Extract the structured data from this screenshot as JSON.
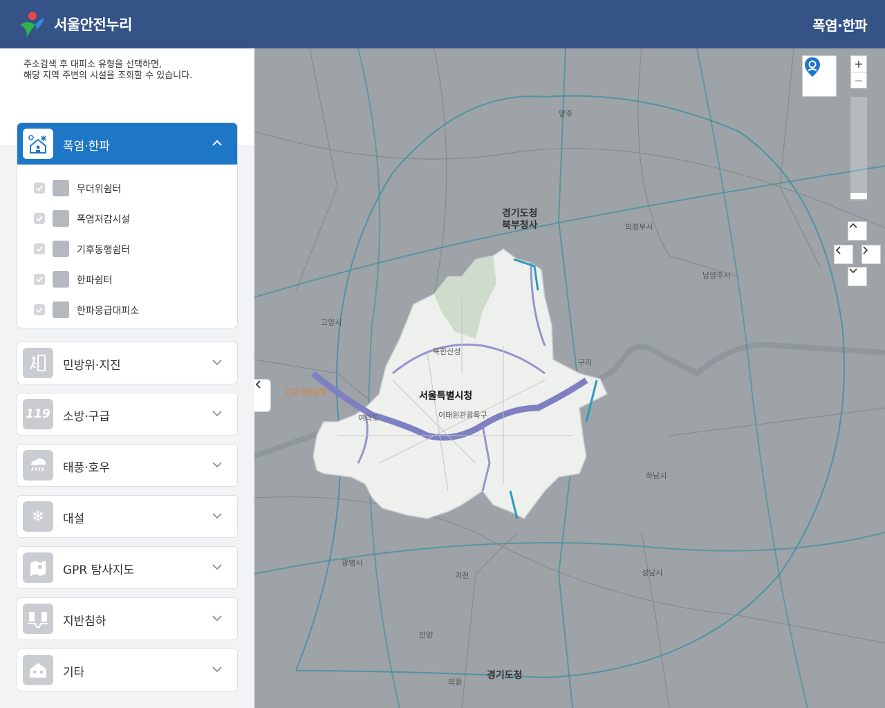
{
  "header": {
    "app_title": "서울안전누리",
    "page_title": "폭염·한파"
  },
  "sidebar": {
    "intro_line1": "주소검색 후 대피소 유형을 선택하면,",
    "intro_line2": "해당 지역 주변의 시설을 조회할 수 있습니다.",
    "open_category": {
      "label": "폭염·한파",
      "icon": "heat-cold-icon",
      "items": [
        {
          "label": "무더위쉼터",
          "icon": "heat-shelter-icon",
          "checked": true
        },
        {
          "label": "폭염저감시설",
          "icon": "heat-reduction-icon",
          "checked": true
        },
        {
          "label": "기후동행쉼터",
          "icon": "climate-shelter-icon",
          "checked": true
        },
        {
          "label": "한파쉼터",
          "icon": "cold-shelter-icon",
          "checked": true
        },
        {
          "label": "한파응급대피소",
          "icon": "cold-emergency-icon",
          "checked": true
        }
      ]
    },
    "categories": [
      {
        "label": "민방위·지진",
        "icon": "evacuation-icon"
      },
      {
        "label": "소방·구급",
        "icon": "fire-119-icon"
      },
      {
        "label": "태풍·호우",
        "icon": "typhoon-rain-icon"
      },
      {
        "label": "대설",
        "icon": "snow-icon"
      },
      {
        "label": "GPR 탐사지도",
        "icon": "gpr-map-icon"
      },
      {
        "label": "지반침하",
        "icon": "sinkhole-icon"
      },
      {
        "label": "기타",
        "icon": "other-building-icon"
      }
    ]
  },
  "map": {
    "labels": {
      "city_hall": "서울특별시청",
      "gyeonggi_north": "경기도청",
      "gyeonggi_north2": "북부청사",
      "gyeonggi_south": "경기도청",
      "gimpo": "김포국제공항",
      "yeouido": "여의도",
      "itaewon": "이태원관광특구",
      "bukhansan": "북한산성",
      "guri": "구리",
      "hanam": "하남시",
      "gwacheon": "과천",
      "seongnam": "성남시",
      "gwangmyeong": "광명시",
      "goyang": "고양시",
      "uijeongbu": "의정부시",
      "namyangju": "남양주시",
      "yangju": "양주",
      "anyang": "안양",
      "uiwang": "의왕"
    },
    "accent_color": "#1e76c7",
    "header_color": "#355387"
  }
}
